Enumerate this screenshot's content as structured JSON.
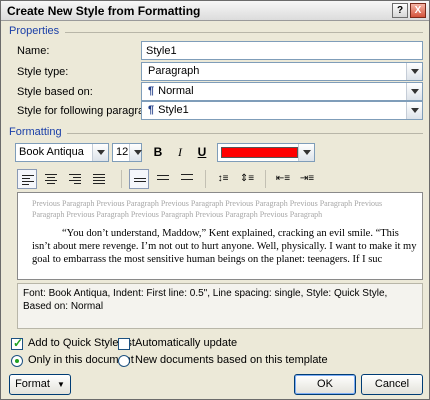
{
  "window": {
    "title": "Create New Style from Formatting",
    "help_glyph": "?",
    "close_glyph": "X"
  },
  "properties": {
    "section_label": "Properties",
    "name_label": "Name:",
    "name_value": "Style1",
    "style_type_label": "Style type:",
    "style_type_value": "Paragraph",
    "based_on_label": "Style based on:",
    "based_on_value": "Normal",
    "following_label": "Style for following paragraph:",
    "following_value": "Style1"
  },
  "formatting": {
    "section_label": "Formatting",
    "font": "Book Antiqua",
    "size": "12",
    "bold": "B",
    "italic": "I",
    "underline": "U",
    "font_color": "#ff0000"
  },
  "preview": {
    "previous_text": "Previous Paragraph Previous Paragraph Previous Paragraph Previous Paragraph Previous Paragraph Previous Paragraph Previous Paragraph Previous Paragraph Previous Paragraph Previous Paragraph",
    "sample_text": "“You don’t understand, Maddow,” Kent explained, cracking an evil smile. “This isn’t about mere revenge. I’m not out to hurt anyone. Well, physically. I want to make it my goal to embarrass the most sensitive human beings on the planet: teenagers. If I suc"
  },
  "description": "Font: Book Antiqua, Indent: First line:  0.5\", Line spacing:  single, Style: Quick Style, Based on: Normal",
  "options": {
    "add_quick_style": "Add to Quick Style list",
    "auto_update": "Automatically update",
    "only_this_doc": "Only in this document",
    "new_docs": "New documents based on this template"
  },
  "buttons": {
    "format": "Format",
    "ok": "OK",
    "cancel": "Cancel"
  }
}
